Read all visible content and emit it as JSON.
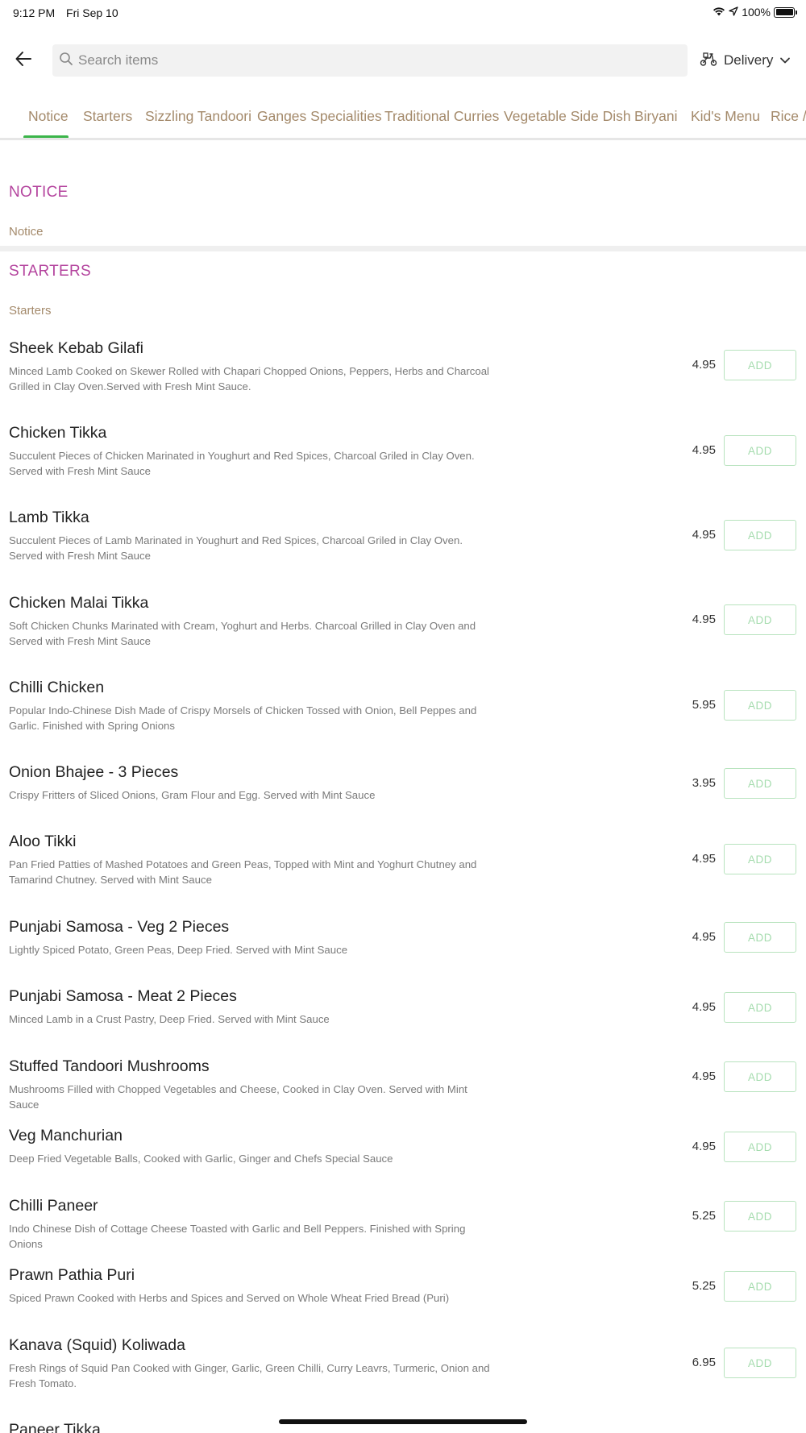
{
  "status_bar": {
    "time": "9:12 PM",
    "date": "Fri Sep 10",
    "battery": "100%",
    "icons": [
      "wifi-icon",
      "location-arrow-icon",
      "battery-icon"
    ]
  },
  "header": {
    "back_icon": "arrow-left-icon",
    "search_placeholder": "Search items",
    "delivery_label": "Delivery",
    "delivery_icon": "scooter-icon"
  },
  "tabs": [
    "Notice",
    "Starters",
    "Sizzling Tandoori",
    "Ganges Specialities",
    "Traditional Curries",
    "Vegetable Side Dish",
    "Biryani",
    "Kid's Menu",
    "Rice / B"
  ],
  "active_tab": "Notice",
  "sections": {
    "notice": {
      "title": "NOTICE",
      "subtitle": "Notice"
    },
    "starters": {
      "title": "STARTERS",
      "subtitle": "Starters"
    }
  },
  "add_label": "ADD",
  "items": [
    {
      "name": "Sheek Kebab Gilafi",
      "desc": "Minced Lamb Cooked on Skewer Rolled with Chapari Chopped Onions, Peppers, Herbs and Charcoal Grilled in Clay Oven.Served with Fresh Mint Sauce.",
      "price": "4.95"
    },
    {
      "name": "Chicken Tikka",
      "desc": "Succulent Pieces of Chicken Marinated in Youghurt and Red Spices, Charcoal Griled in Clay Oven. Served with Fresh Mint Sauce",
      "price": "4.95"
    },
    {
      "name": "Lamb Tikka",
      "desc": "Succulent Pieces of Lamb Marinated in Youghurt and Red Spices, Charcoal Griled in Clay Oven. Served with Fresh Mint Sauce",
      "price": "4.95"
    },
    {
      "name": "Chicken Malai Tikka",
      "desc": "Soft Chicken Chunks Marinated with Cream, Yoghurt and Herbs. Charcoal Grilled in Clay Oven and Served with Fresh Mint Sauce",
      "price": "4.95"
    },
    {
      "name": "Chilli Chicken",
      "desc": "Popular Indo-Chinese Dish Made of Crispy Morsels of Chicken Tossed with Onion, Bell Peppes and Garlic. Finished with Spring Onions",
      "price": "5.95"
    },
    {
      "name": "Onion Bhajee - 3 Pieces",
      "desc": "Crispy Fritters of Sliced Onions, Gram Flour and Egg. Served with Mint Sauce",
      "price": "3.95"
    },
    {
      "name": "Aloo Tikki",
      "desc": "Pan Fried Patties of Mashed Potatoes and Green Peas, Topped with Mint and Yoghurt Chutney and Tamarind Chutney. Served with Mint Sauce",
      "price": "4.95"
    },
    {
      "name": "Punjabi Samosa - Veg 2 Pieces",
      "desc": "Lightly Spiced Potato, Green Peas, Deep Fried. Served with Mint Sauce",
      "price": "4.95"
    },
    {
      "name": "Punjabi Samosa - Meat 2 Pieces",
      "desc": "Minced Lamb in a Crust Pastry, Deep Fried. Served with Mint Sauce",
      "price": "4.95"
    },
    {
      "name": "Stuffed Tandoori Mushrooms",
      "desc": "Mushrooms Filled with Chopped Vegetables and Cheese, Cooked in Clay Oven. Served with Mint Sauce",
      "price": "4.95"
    },
    {
      "name": "Veg Manchurian",
      "desc": "Deep Fried Vegetable Balls, Cooked with Garlic, Ginger and Chefs Special Sauce",
      "price": "4.95"
    },
    {
      "name": "Chilli Paneer",
      "desc": "Indo Chinese Dish of Cottage Cheese Toasted with Garlic and Bell Peppers. Finished with Spring Onions",
      "price": "5.25"
    },
    {
      "name": "Prawn Pathia Puri",
      "desc": "Spiced Prawn Cooked with Herbs and Spices and Served on Whole Wheat Fried Bread (Puri)",
      "price": "5.25"
    },
    {
      "name": "Kanava (Squid) Koliwada",
      "desc": "Fresh Rings of Squid Pan Cooked with Ginger, Garlic, Green Chilli, Curry Leavrs, Turmeric, Onion and Fresh Tomato.",
      "price": "6.95"
    },
    {
      "name": "Paneer Tikka",
      "desc": "",
      "price": ""
    }
  ],
  "colors": {
    "section_title": "#b4449e",
    "tab_text": "#a48a6b",
    "tab_indicator": "#3bb54a",
    "add_button_border": "#b8e3be"
  }
}
